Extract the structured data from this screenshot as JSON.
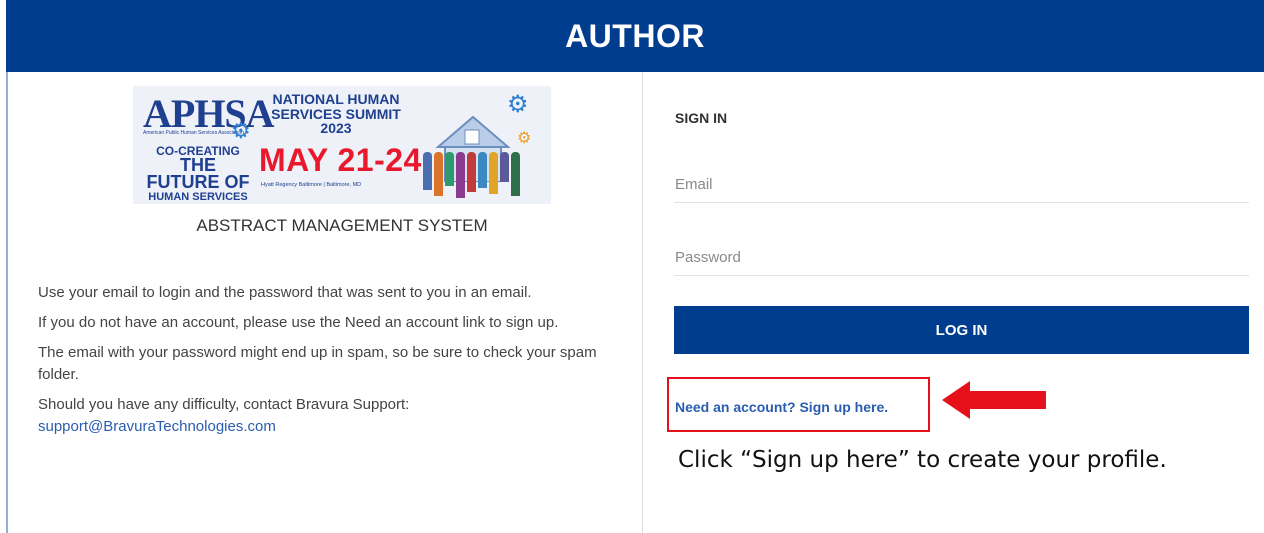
{
  "header": {
    "title": "AUTHOR"
  },
  "banner": {
    "logo": "APHSA",
    "logo_sub": "American Public Human Services Association",
    "tagline_1": "CO-CREATING",
    "tagline_2": "THE FUTURE OF",
    "tagline_3": "HUMAN SERVICES",
    "summit": "NATIONAL HUMAN SERVICES SUMMIT 2023",
    "dates": "MAY 21-24",
    "venue": "Hyatt Regency Baltimore | Baltimore, MD"
  },
  "left": {
    "system_title": "ABSTRACT MANAGEMENT SYSTEM",
    "instructions": [
      "Use your email to login and the password that was sent to you in an email.",
      "If you do not have an account, please use the Need an account link to sign up.",
      "The email with your password might end up in spam, so be sure to check your spam folder.",
      "Should you have any difficulty, contact Bravura Support:"
    ],
    "support_email": "support@BravuraTechnologies.com"
  },
  "signin": {
    "title": "SIGN IN",
    "email_placeholder": "Email",
    "email_value": "",
    "password_placeholder": "Password",
    "password_value": "",
    "login_label": "LOG IN",
    "signup_link": "Need an account? Sign up here."
  },
  "annotation": {
    "text": "Click “Sign up here” to create your profile.",
    "highlight_color": "#e5101a"
  },
  "colors": {
    "brand": "#003d8f",
    "link": "#2a5db0",
    "date_red": "#e8192c"
  }
}
